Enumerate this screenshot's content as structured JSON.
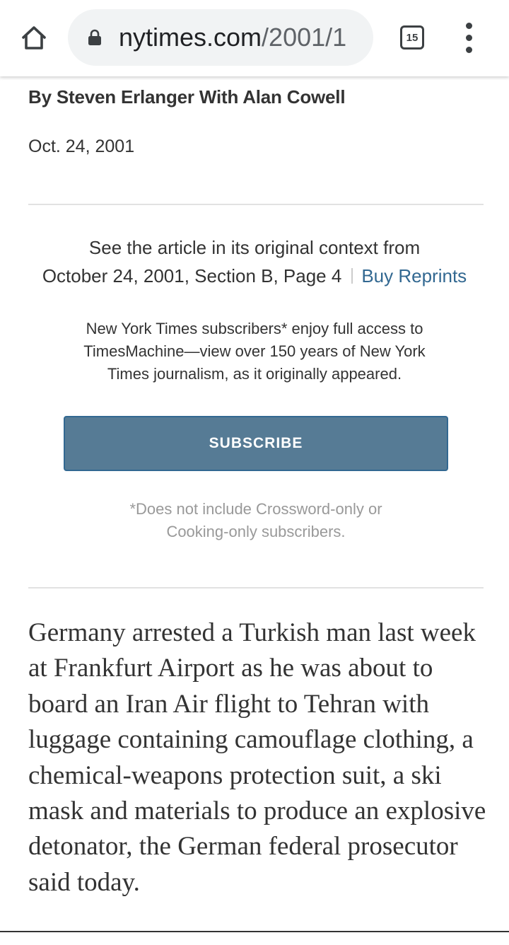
{
  "browser": {
    "url_domain": "nytimes.com",
    "url_path": "/2001/1",
    "tab_count": "15"
  },
  "article": {
    "byline": "By Steven Erlanger With Alan Cowell",
    "date": "Oct. 24, 2001",
    "context_line1": "See the article in its original context from",
    "context_line2": "October 24, 2001, Section B, Page 4",
    "buy_reprints": "Buy Reprints",
    "timesmachine_note": "New York Times subscribers* enjoy full access to TimesMachine—view over 150 years of New York Times journalism, as it originally appeared.",
    "subscribe_label": "SUBSCRIBE",
    "disclaimer": "*Does not include Crossword-only or Cooking-only subscribers.",
    "body_paragraph": "Germany arrested a Turkish man last week at Frankfurt Airport as he was about to board an Iran Air flight to Tehran with luggage containing camouflage clothing, a chemical-weapons protection suit, a ski mask and materials to produce an explosive detonator, the German federal prosecutor said today."
  },
  "icons": {
    "home": "home-icon",
    "lock": "lock-icon",
    "tabs": "tab-switcher-icon",
    "menu": "more-vert-icon"
  },
  "colors": {
    "link": "#326891",
    "subscribe_button": "#567b95",
    "urlbar_bg": "#f1f3f4"
  }
}
